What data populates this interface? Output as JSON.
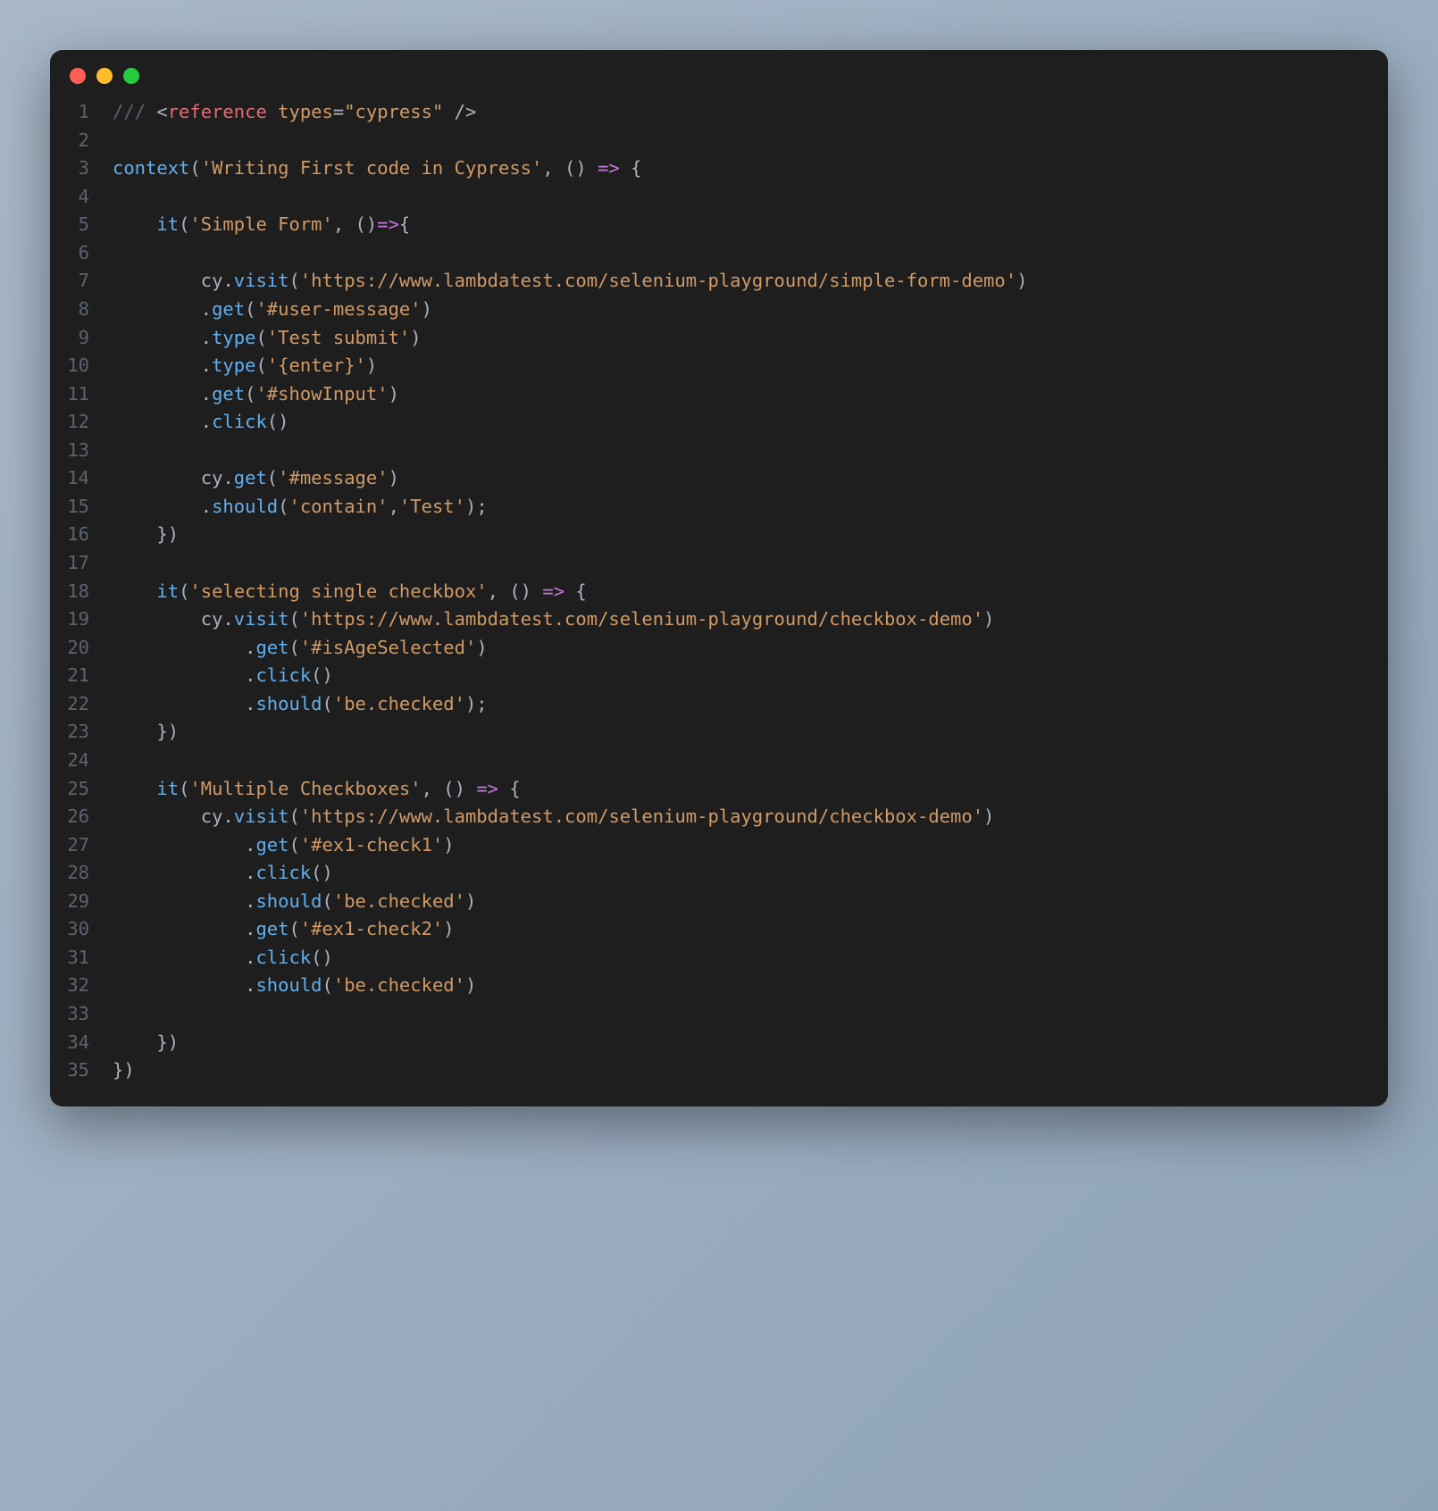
{
  "window": {
    "traffic_lights": [
      "red",
      "yellow",
      "green"
    ]
  },
  "code_lines": [
    {
      "n": 1,
      "tokens": [
        {
          "c": "c-comment",
          "t": "/// "
        },
        {
          "c": "c-punct",
          "t": "<"
        },
        {
          "c": "c-keyword",
          "t": "reference"
        },
        {
          "c": "c-plain",
          "t": " "
        },
        {
          "c": "c-attr",
          "t": "types"
        },
        {
          "c": "c-punct",
          "t": "="
        },
        {
          "c": "c-string",
          "t": "\"cypress\""
        },
        {
          "c": "c-plain",
          "t": " "
        },
        {
          "c": "c-punct",
          "t": "/>"
        }
      ]
    },
    {
      "n": 2,
      "tokens": []
    },
    {
      "n": 3,
      "tokens": [
        {
          "c": "c-func",
          "t": "context"
        },
        {
          "c": "c-punct",
          "t": "("
        },
        {
          "c": "c-string",
          "t": "'Writing First code in Cypress'"
        },
        {
          "c": "c-punct",
          "t": ", () "
        },
        {
          "c": "c-arrow",
          "t": "=>"
        },
        {
          "c": "c-punct",
          "t": " {"
        }
      ]
    },
    {
      "n": 4,
      "tokens": []
    },
    {
      "n": 5,
      "tokens": [
        {
          "c": "c-plain",
          "t": "    "
        },
        {
          "c": "c-func",
          "t": "it"
        },
        {
          "c": "c-punct",
          "t": "("
        },
        {
          "c": "c-string",
          "t": "'Simple Form'"
        },
        {
          "c": "c-punct",
          "t": ", ()"
        },
        {
          "c": "c-arrow",
          "t": "=>"
        },
        {
          "c": "c-punct",
          "t": "{"
        }
      ]
    },
    {
      "n": 6,
      "tokens": []
    },
    {
      "n": 7,
      "tokens": [
        {
          "c": "c-plain",
          "t": "        cy."
        },
        {
          "c": "c-func",
          "t": "visit"
        },
        {
          "c": "c-punct",
          "t": "("
        },
        {
          "c": "c-string",
          "t": "'https://www.lambdatest.com/selenium-playground/simple-form-demo'"
        },
        {
          "c": "c-punct",
          "t": ")"
        }
      ]
    },
    {
      "n": 8,
      "tokens": [
        {
          "c": "c-plain",
          "t": "        ."
        },
        {
          "c": "c-func",
          "t": "get"
        },
        {
          "c": "c-punct",
          "t": "("
        },
        {
          "c": "c-string",
          "t": "'#user-message'"
        },
        {
          "c": "c-punct",
          "t": ")"
        }
      ]
    },
    {
      "n": 9,
      "tokens": [
        {
          "c": "c-plain",
          "t": "        ."
        },
        {
          "c": "c-func",
          "t": "type"
        },
        {
          "c": "c-punct",
          "t": "("
        },
        {
          "c": "c-string",
          "t": "'Test submit'"
        },
        {
          "c": "c-punct",
          "t": ")"
        }
      ]
    },
    {
      "n": 10,
      "tokens": [
        {
          "c": "c-plain",
          "t": "        ."
        },
        {
          "c": "c-func",
          "t": "type"
        },
        {
          "c": "c-punct",
          "t": "("
        },
        {
          "c": "c-string",
          "t": "'{enter}'"
        },
        {
          "c": "c-punct",
          "t": ")"
        }
      ]
    },
    {
      "n": 11,
      "tokens": [
        {
          "c": "c-plain",
          "t": "        ."
        },
        {
          "c": "c-func",
          "t": "get"
        },
        {
          "c": "c-punct",
          "t": "("
        },
        {
          "c": "c-string",
          "t": "'#showInput'"
        },
        {
          "c": "c-punct",
          "t": ")"
        }
      ]
    },
    {
      "n": 12,
      "tokens": [
        {
          "c": "c-plain",
          "t": "        ."
        },
        {
          "c": "c-func",
          "t": "click"
        },
        {
          "c": "c-punct",
          "t": "()"
        }
      ]
    },
    {
      "n": 13,
      "tokens": []
    },
    {
      "n": 14,
      "tokens": [
        {
          "c": "c-plain",
          "t": "        cy."
        },
        {
          "c": "c-func",
          "t": "get"
        },
        {
          "c": "c-punct",
          "t": "("
        },
        {
          "c": "c-string",
          "t": "'#message'"
        },
        {
          "c": "c-punct",
          "t": ")"
        }
      ]
    },
    {
      "n": 15,
      "tokens": [
        {
          "c": "c-plain",
          "t": "        ."
        },
        {
          "c": "c-func",
          "t": "should"
        },
        {
          "c": "c-punct",
          "t": "("
        },
        {
          "c": "c-string",
          "t": "'contain'"
        },
        {
          "c": "c-punct",
          "t": ","
        },
        {
          "c": "c-string",
          "t": "'Test'"
        },
        {
          "c": "c-punct",
          "t": ");"
        }
      ]
    },
    {
      "n": 16,
      "tokens": [
        {
          "c": "c-punct",
          "t": "    })"
        }
      ]
    },
    {
      "n": 17,
      "tokens": []
    },
    {
      "n": 18,
      "tokens": [
        {
          "c": "c-plain",
          "t": "    "
        },
        {
          "c": "c-func",
          "t": "it"
        },
        {
          "c": "c-punct",
          "t": "("
        },
        {
          "c": "c-string",
          "t": "'selecting single checkbox'"
        },
        {
          "c": "c-punct",
          "t": ", () "
        },
        {
          "c": "c-arrow",
          "t": "=>"
        },
        {
          "c": "c-punct",
          "t": " {"
        }
      ]
    },
    {
      "n": 19,
      "tokens": [
        {
          "c": "c-plain",
          "t": "        cy."
        },
        {
          "c": "c-func",
          "t": "visit"
        },
        {
          "c": "c-punct",
          "t": "("
        },
        {
          "c": "c-string",
          "t": "'https://www.lambdatest.com/selenium-playground/checkbox-demo'"
        },
        {
          "c": "c-punct",
          "t": ")"
        }
      ]
    },
    {
      "n": 20,
      "tokens": [
        {
          "c": "c-plain",
          "t": "            ."
        },
        {
          "c": "c-func",
          "t": "get"
        },
        {
          "c": "c-punct",
          "t": "("
        },
        {
          "c": "c-string",
          "t": "'#isAgeSelected'"
        },
        {
          "c": "c-punct",
          "t": ")"
        }
      ]
    },
    {
      "n": 21,
      "tokens": [
        {
          "c": "c-plain",
          "t": "            ."
        },
        {
          "c": "c-func",
          "t": "click"
        },
        {
          "c": "c-punct",
          "t": "()"
        }
      ]
    },
    {
      "n": 22,
      "tokens": [
        {
          "c": "c-plain",
          "t": "            ."
        },
        {
          "c": "c-func",
          "t": "should"
        },
        {
          "c": "c-punct",
          "t": "("
        },
        {
          "c": "c-string",
          "t": "'be.checked'"
        },
        {
          "c": "c-punct",
          "t": ");"
        }
      ]
    },
    {
      "n": 23,
      "tokens": [
        {
          "c": "c-punct",
          "t": "    })"
        }
      ]
    },
    {
      "n": 24,
      "tokens": []
    },
    {
      "n": 25,
      "tokens": [
        {
          "c": "c-plain",
          "t": "    "
        },
        {
          "c": "c-func",
          "t": "it"
        },
        {
          "c": "c-punct",
          "t": "("
        },
        {
          "c": "c-string",
          "t": "'Multiple Checkboxes'"
        },
        {
          "c": "c-punct",
          "t": ", () "
        },
        {
          "c": "c-arrow",
          "t": "=>"
        },
        {
          "c": "c-punct",
          "t": " {"
        }
      ]
    },
    {
      "n": 26,
      "tokens": [
        {
          "c": "c-plain",
          "t": "        cy."
        },
        {
          "c": "c-func",
          "t": "visit"
        },
        {
          "c": "c-punct",
          "t": "("
        },
        {
          "c": "c-string",
          "t": "'https://www.lambdatest.com/selenium-playground/checkbox-demo'"
        },
        {
          "c": "c-punct",
          "t": ")"
        }
      ]
    },
    {
      "n": 27,
      "tokens": [
        {
          "c": "c-plain",
          "t": "            ."
        },
        {
          "c": "c-func",
          "t": "get"
        },
        {
          "c": "c-punct",
          "t": "("
        },
        {
          "c": "c-string",
          "t": "'#ex1-check1'"
        },
        {
          "c": "c-punct",
          "t": ")"
        }
      ]
    },
    {
      "n": 28,
      "tokens": [
        {
          "c": "c-plain",
          "t": "            ."
        },
        {
          "c": "c-func",
          "t": "click"
        },
        {
          "c": "c-punct",
          "t": "()"
        }
      ]
    },
    {
      "n": 29,
      "tokens": [
        {
          "c": "c-plain",
          "t": "            ."
        },
        {
          "c": "c-func",
          "t": "should"
        },
        {
          "c": "c-punct",
          "t": "("
        },
        {
          "c": "c-string",
          "t": "'be.checked'"
        },
        {
          "c": "c-punct",
          "t": ")"
        }
      ]
    },
    {
      "n": 30,
      "tokens": [
        {
          "c": "c-plain",
          "t": "            ."
        },
        {
          "c": "c-func",
          "t": "get"
        },
        {
          "c": "c-punct",
          "t": "("
        },
        {
          "c": "c-string",
          "t": "'#ex1-check2'"
        },
        {
          "c": "c-punct",
          "t": ")"
        }
      ]
    },
    {
      "n": 31,
      "tokens": [
        {
          "c": "c-plain",
          "t": "            ."
        },
        {
          "c": "c-func",
          "t": "click"
        },
        {
          "c": "c-punct",
          "t": "()"
        }
      ]
    },
    {
      "n": 32,
      "tokens": [
        {
          "c": "c-plain",
          "t": "            ."
        },
        {
          "c": "c-func",
          "t": "should"
        },
        {
          "c": "c-punct",
          "t": "("
        },
        {
          "c": "c-string",
          "t": "'be.checked'"
        },
        {
          "c": "c-punct",
          "t": ")"
        }
      ]
    },
    {
      "n": 33,
      "tokens": []
    },
    {
      "n": 34,
      "tokens": [
        {
          "c": "c-punct",
          "t": "    })"
        }
      ]
    },
    {
      "n": 35,
      "tokens": [
        {
          "c": "c-punct",
          "t": "})"
        }
      ]
    }
  ]
}
